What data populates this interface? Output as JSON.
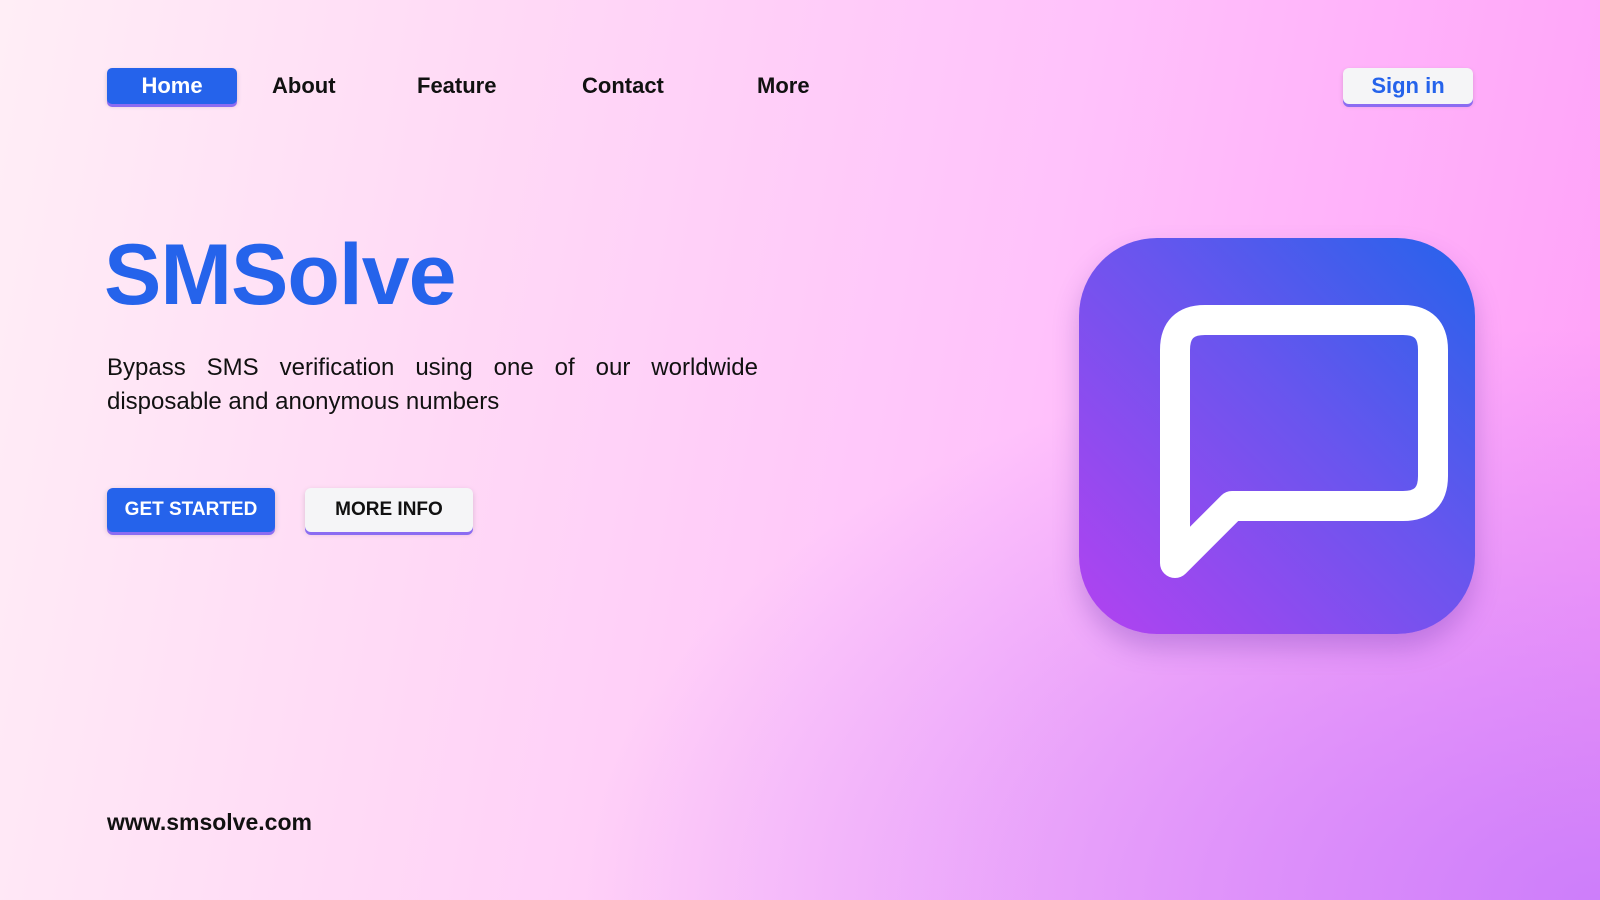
{
  "nav": {
    "items": [
      {
        "label": "Home",
        "active": true
      },
      {
        "label": "About"
      },
      {
        "label": "Feature"
      },
      {
        "label": "Contact"
      },
      {
        "label": "More"
      }
    ],
    "signin_label": "Sign in"
  },
  "hero": {
    "title": "SMSolve",
    "subtitle": "Bypass SMS verification using one of our worldwide disposable and anonymous numbers",
    "primary_button": "GET STARTED",
    "secondary_button": "MORE INFO"
  },
  "app_icon": {
    "name": "chat-bubble-icon",
    "gradient_colors": [
      "#2563eb",
      "#6a55ee",
      "#b342f0"
    ]
  },
  "footer": {
    "url": "www.smsolve.com"
  },
  "colors": {
    "accent": "#2563eb",
    "button_underline": "#8b6cf2",
    "text": "#111111",
    "background_start": "#ffeef6",
    "background_end": "#ff9ef8"
  }
}
